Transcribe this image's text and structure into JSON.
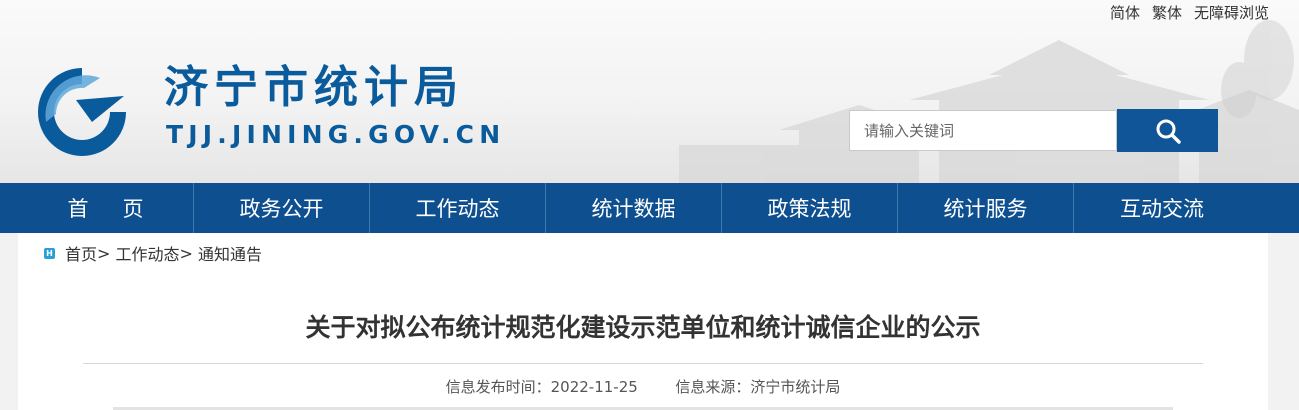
{
  "toplinks": {
    "simplified": "简体",
    "traditional": "繁体",
    "accessible": "无障碍浏览"
  },
  "header": {
    "title": "济宁市统计局",
    "domain": "TJJ.JINING.GOV.CN"
  },
  "search": {
    "placeholder": "请输入关键词"
  },
  "nav": {
    "items": [
      {
        "label": "首页"
      },
      {
        "label": "政务公开"
      },
      {
        "label": "工作动态"
      },
      {
        "label": "统计数据"
      },
      {
        "label": "政策法规"
      },
      {
        "label": "统计服务"
      },
      {
        "label": "互动交流"
      }
    ]
  },
  "breadcrumb": {
    "icon_letter": "H",
    "home": "首页",
    "sep": ">",
    "section": "工作动态",
    "current": "通知通告"
  },
  "article": {
    "title": "关于对拟公布统计规范化建设示范单位和统计诚信企业的公示",
    "date_label": "信息发布时间：",
    "date": "2022-11-25",
    "source_label": "信息来源：",
    "source": "济宁市统计局"
  },
  "colors": {
    "brand": "#0a5b9c",
    "nav_bg": "#0e4f8f",
    "search_btn": "#0f5597"
  }
}
